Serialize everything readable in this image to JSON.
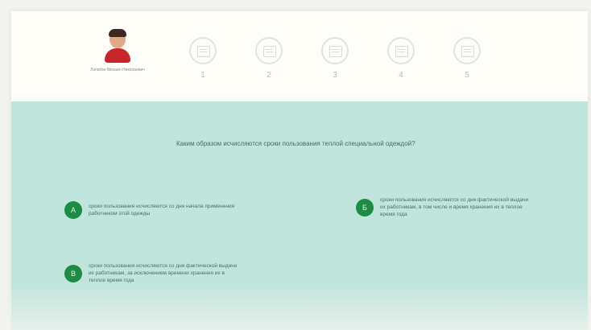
{
  "player": {
    "name": "Лопатин Михаил Николаевич"
  },
  "steps": [
    {
      "label": "1"
    },
    {
      "label": "2"
    },
    {
      "label": "3"
    },
    {
      "label": "4"
    },
    {
      "label": "5"
    }
  ],
  "question": {
    "text": "Каким образом исчисляются сроки пользования теплой специальной одеждой?"
  },
  "answers": [
    {
      "letter": "А",
      "text": "сроки пользования исчисляются со дня начала применения работником этой одежды"
    },
    {
      "letter": "Б",
      "text": "сроки пользования исчисляются со дня фактической выдачи их работникам, в том числе и время хранения их в теплое время года"
    },
    {
      "letter": "В",
      "text": "сроки пользования исчисляются со дня фактической выдачи их работникам, за исключением времени хранения их в теплое время года"
    }
  ],
  "colors": {
    "quiz_background": "#bfe5dc",
    "badge": "#1e8b45",
    "header_background": "#fefdf8"
  },
  "icons": {
    "step": "document-icon"
  }
}
